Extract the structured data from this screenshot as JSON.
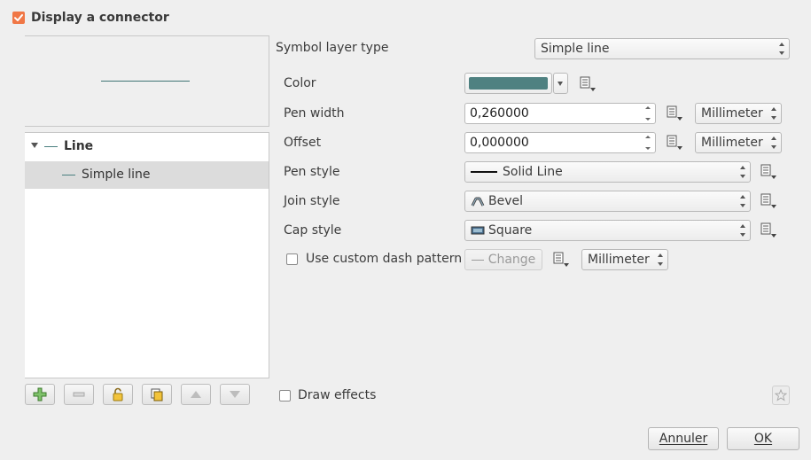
{
  "header": {
    "checkbox_label": "Display a connector",
    "checked": true
  },
  "tree": {
    "parent_label": "Line",
    "child_label": "Simple line"
  },
  "form": {
    "symbol_layer_type_label": "Symbol layer type",
    "symbol_layer_type_value": "Simple line",
    "color_label": "Color",
    "color_value": "#4f8181",
    "pen_width_label": "Pen width",
    "pen_width_value": "0,260000",
    "pen_width_unit": "Millimeter",
    "offset_label": "Offset",
    "offset_value": "0,000000",
    "offset_unit": "Millimeter",
    "pen_style_label": "Pen style",
    "pen_style_value": "Solid Line",
    "join_style_label": "Join style",
    "join_style_value": "Bevel",
    "cap_style_label": "Cap style",
    "cap_style_value": "Square",
    "custom_dash_label": "Use custom dash pattern",
    "custom_dash_checked": false,
    "change_button": "Change",
    "dash_unit": "Millimeter",
    "draw_effects_label": "Draw effects",
    "draw_effects_checked": false
  },
  "footer": {
    "cancel_label": "Annuler",
    "ok_label": "OK"
  },
  "toolbar_icons": [
    "add-layer-icon",
    "remove-layer-icon",
    "lock-icon",
    "duplicate-icon",
    "move-up-icon",
    "move-down-icon"
  ]
}
